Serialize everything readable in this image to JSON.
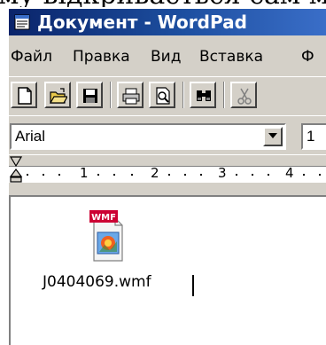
{
  "top_cut_text": "му відкривається сам м",
  "window": {
    "title": "Документ - WordPad"
  },
  "menu": {
    "items": [
      "Файл",
      "Правка",
      "Вид",
      "Вставка",
      "Ф"
    ]
  },
  "toolbar": {
    "buttons": [
      {
        "name": "new-document-icon"
      },
      {
        "name": "open-folder-icon"
      },
      {
        "name": "save-disk-icon"
      },
      {
        "name": "print-icon"
      },
      {
        "name": "print-preview-icon"
      },
      {
        "name": "find-binoculars-icon"
      },
      {
        "name": "cut-scissors-icon"
      }
    ]
  },
  "format": {
    "font": "Arial",
    "size": "1"
  },
  "ruler": {
    "labels": [
      "1",
      "2",
      "3",
      "4"
    ]
  },
  "document": {
    "object_badge": "WMF",
    "object_filename": "J0404069.wmf"
  },
  "colors": {
    "title_bar": "#0a246a",
    "chrome": "#d4d0c8",
    "icon_badge": "#cc0033"
  }
}
